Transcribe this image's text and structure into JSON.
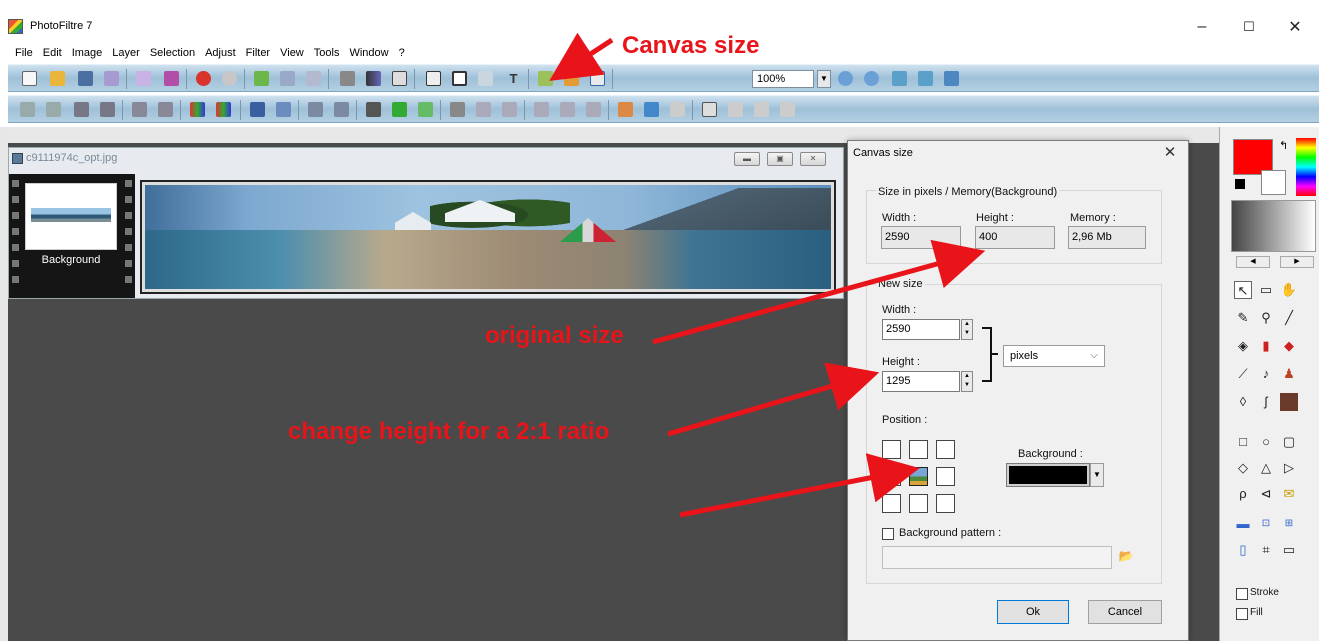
{
  "window": {
    "title": "PhotoFiltre 7",
    "minimize": "–",
    "maximize": "☐",
    "close": "✕"
  },
  "menu": [
    "File",
    "Edit",
    "Image",
    "Layer",
    "Selection",
    "Adjust",
    "Filter",
    "View",
    "Tools",
    "Window",
    "?"
  ],
  "toolbar": {
    "zoom": "100%"
  },
  "image_window": {
    "title": "c9111974c_opt.jpg",
    "layer_name": "Background"
  },
  "dialog": {
    "title": "Canvas size",
    "close": "✕",
    "current_group": "Size in pixels / Memory(Background)",
    "width_label": "Width :",
    "height_label": "Height :",
    "memory_label": "Memory :",
    "width_value": "2590",
    "height_value": "400",
    "memory_value": "2,96 Mb",
    "new_group": "New size",
    "new_width_label": "Width :",
    "new_width_value": "2590",
    "new_height_label": "Height :",
    "new_height_value": "1295",
    "unit_selected": "pixels",
    "position_label": "Position :",
    "background_label": "Background :",
    "background_color": "#000000",
    "pattern_label": "Background pattern :",
    "ok": "Ok",
    "cancel": "Cancel"
  },
  "palette": {
    "stroke_label": "Stroke",
    "fill_label": "Fill",
    "primary_color": "#ff0000"
  },
  "annotations": {
    "canvas_size": "Canvas size",
    "original_size": "original size",
    "change_height": "change height for a 2:1 ratio"
  }
}
